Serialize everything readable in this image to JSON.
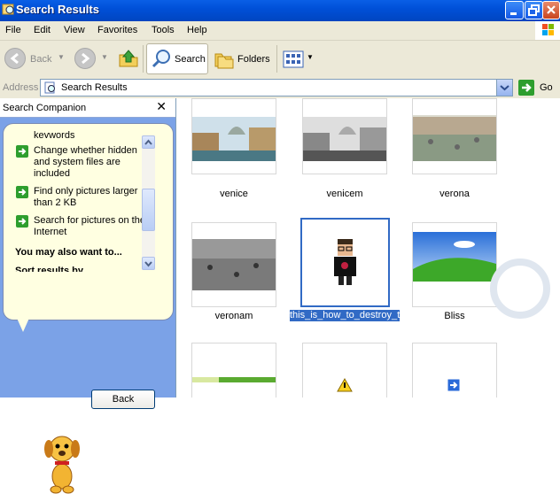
{
  "window": {
    "title": "Search Results"
  },
  "menu": [
    "File",
    "Edit",
    "View",
    "Favorites",
    "Tools",
    "Help"
  ],
  "toolbar": {
    "back_label": "Back",
    "search_label": "Search",
    "folders_label": "Folders"
  },
  "address": {
    "label": "Address",
    "value": "Search Results",
    "go_label": "Go"
  },
  "companion": {
    "title": "Search Companion",
    "partial_top_text": "keywords",
    "options": [
      {
        "label": "Change whether hidden and system files are included"
      },
      {
        "label": "Find only pictures larger than 2 KB"
      },
      {
        "label": "Search for pictures on the Internet"
      }
    ],
    "also_heading": "You may also want to...",
    "partial_bottom_text": "Sort results by",
    "back_button": "Back"
  },
  "files": [
    {
      "name": "venice",
      "style": "color"
    },
    {
      "name": "venicem",
      "style": "mono"
    },
    {
      "name": "verona",
      "style": "color"
    },
    {
      "name": "veronam",
      "style": "mono"
    },
    {
      "name": "this_is_how_to_destroy_troy",
      "style": "avatar",
      "selected": true
    },
    {
      "name": "Bliss",
      "style": "bliss"
    }
  ],
  "colors": {
    "titlebar": "#0050d8",
    "selection": "#316ac5",
    "pane": "#7ba2e7"
  }
}
